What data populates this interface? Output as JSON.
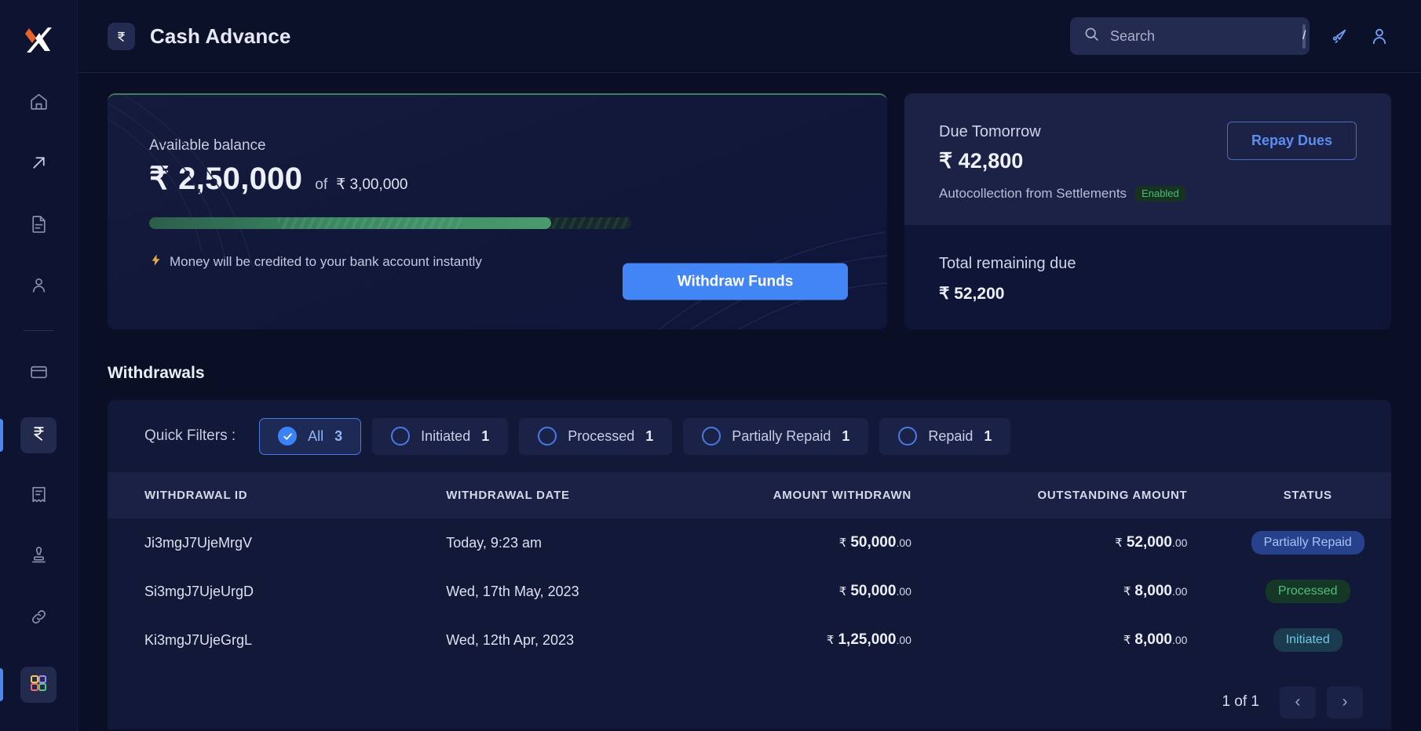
{
  "sidebar": {
    "logo": "x-logo",
    "items": [
      {
        "name": "home",
        "icon": "home-icon"
      },
      {
        "name": "payouts",
        "icon": "arrow-up-right-icon"
      },
      {
        "name": "documents",
        "icon": "document-icon"
      },
      {
        "name": "contacts",
        "icon": "person-icon"
      },
      {
        "name": "cards",
        "icon": "credit-card-icon"
      },
      {
        "name": "cash-advance",
        "icon": "rupee-icon"
      },
      {
        "name": "invoices",
        "icon": "receipt-icon"
      },
      {
        "name": "tax",
        "icon": "stamp-icon"
      },
      {
        "name": "integrations",
        "icon": "link-icon"
      },
      {
        "name": "apps",
        "icon": "grid-apps-icon"
      }
    ]
  },
  "header": {
    "badge_icon": "rupee-icon",
    "title": "Cash Advance",
    "search": {
      "icon": "search-icon",
      "placeholder": "Search",
      "value": "",
      "shortcut": "/"
    },
    "announcement_icon": "megaphone-icon",
    "profile_icon": "user-avatar-icon"
  },
  "balance_card": {
    "label": "Available balance",
    "amount": "₹ 2,50,000",
    "of_label": "of",
    "total": "₹ 3,00,000",
    "progress_percent": 83.33,
    "note_icon": "lightning-icon",
    "note": "Money will be credited to your bank account instantly",
    "withdraw_button": "Withdraw Funds"
  },
  "due_card": {
    "due_label": "Due Tomorrow",
    "due_amount": "₹ 42,800",
    "autocollection_label": "Autocollection from Settlements",
    "autocollection_status": "Enabled",
    "repay_button": "Repay Dues",
    "total_remaining_label": "Total remaining due",
    "total_remaining_amount": "₹ 52,200"
  },
  "withdrawals": {
    "section_title": "Withdrawals",
    "filters_label": "Quick Filters :",
    "filters": [
      {
        "label": "All",
        "count": "3",
        "selected": true
      },
      {
        "label": "Initiated",
        "count": "1",
        "selected": false
      },
      {
        "label": "Processed",
        "count": "1",
        "selected": false
      },
      {
        "label": "Partially Repaid",
        "count": "1",
        "selected": false
      },
      {
        "label": "Repaid",
        "count": "1",
        "selected": false
      }
    ],
    "columns": [
      "WITHDRAWAL ID",
      "WITHDRAWAL DATE",
      "AMOUNT WITHDRAWN",
      "OUTSTANDING AMOUNT",
      "STATUS"
    ],
    "rows": [
      {
        "id": "Ji3mgJ7UjeMrgV",
        "date": "Today, 9:23 am",
        "amount_currency": "₹",
        "amount_main": "50,000",
        "amount_decimals": ".00",
        "outstanding_currency": "₹",
        "outstanding_main": "52,000",
        "outstanding_decimals": ".00",
        "status": "Partially Repaid",
        "status_class": "partially-repaid"
      },
      {
        "id": "Si3mgJ7UjeUrgD",
        "date": "Wed, 17th May, 2023",
        "amount_currency": "₹",
        "amount_main": "50,000",
        "amount_decimals": ".00",
        "outstanding_currency": "₹",
        "outstanding_main": "8,000",
        "outstanding_decimals": ".00",
        "status": "Processed",
        "status_class": "processed"
      },
      {
        "id": "Ki3mgJ7UjeGrgL",
        "date": "Wed, 12th Apr, 2023",
        "amount_currency": "₹",
        "amount_main": "1,25,000",
        "amount_decimals": ".00",
        "outstanding_currency": "₹",
        "outstanding_main": "8,000",
        "outstanding_decimals": ".00",
        "status": "Initiated",
        "status_class": "initiated"
      }
    ],
    "pagination": {
      "text": "1 of 1",
      "prev_icon": "chevron-left-icon",
      "next_icon": "chevron-right-icon"
    }
  },
  "colors": {
    "accent_blue": "#4285f4",
    "progress_green": "#4a9a6d",
    "background": "#0a0f25",
    "card": "#121838",
    "logo_orange": "#e8622a"
  }
}
